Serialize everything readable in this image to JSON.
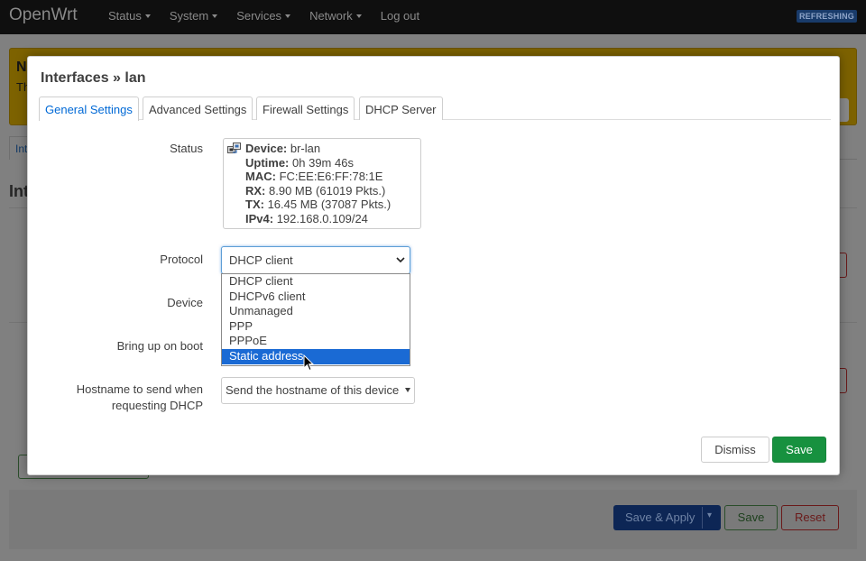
{
  "nav": {
    "brand": "OpenWrt",
    "menu": [
      {
        "label": "Status",
        "has_caret": true
      },
      {
        "label": "System",
        "has_caret": true
      },
      {
        "label": "Services",
        "has_caret": true
      },
      {
        "label": "Network",
        "has_caret": true
      },
      {
        "label": "Log out",
        "has_caret": false
      }
    ],
    "badge": "REFRESHING"
  },
  "background": {
    "alert_initial": "N",
    "alert_text_initial": "Th",
    "tab_label": "Int",
    "heading": "Int",
    "footer": {
      "save_apply": "Save & Apply",
      "save_apply_dropdown": "▾",
      "save": "Save",
      "reset": "Reset"
    }
  },
  "modal": {
    "title": "Interfaces » lan",
    "tabs": [
      {
        "label": "General Settings",
        "active": true
      },
      {
        "label": "Advanced Settings",
        "active": false
      },
      {
        "label": "Firewall Settings",
        "active": false
      },
      {
        "label": "DHCP Server",
        "active": false
      }
    ],
    "status": {
      "label": "Status",
      "icon": "ethernet-ports-icon",
      "device_key": "Device:",
      "device": "br-lan",
      "uptime_key": "Uptime:",
      "uptime": "0h 39m 46s",
      "mac_key": "MAC:",
      "mac": "FC:EE:E6:FF:78:1E",
      "rx_key": "RX:",
      "rx": "8.90 MB (61019 Pkts.)",
      "tx_key": "TX:",
      "tx": "16.45 MB (37087 Pkts.)",
      "ipv4_key": "IPv4:",
      "ipv4": "192.168.0.109/24"
    },
    "protocol": {
      "label": "Protocol",
      "value": "DHCP client",
      "options": [
        "DHCP client",
        "DHCPv6 client",
        "Unmanaged",
        "PPP",
        "PPPoE",
        "Static address"
      ],
      "highlighted": "Static address"
    },
    "device_label": "Device",
    "boot_label": "Bring up on boot",
    "hostname": {
      "label_line1": "Hostname to send when",
      "label_line2": "requesting DHCP",
      "value": "Send the hostname of this device"
    },
    "buttons": {
      "dismiss": "Dismiss",
      "save": "Save"
    }
  },
  "colors": {
    "accent": "#0069d6",
    "save_green": "#17913f",
    "highlight": "#1a6ad4",
    "topbar": "#0f0f0f"
  }
}
